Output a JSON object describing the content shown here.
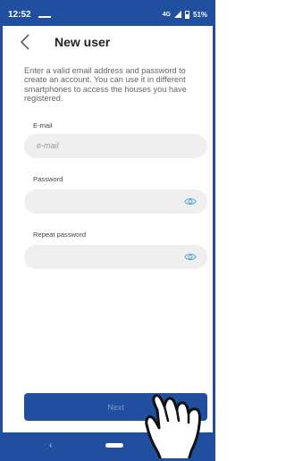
{
  "status_bar": {
    "time": "12:52",
    "network": "4G",
    "battery": "51%"
  },
  "header": {
    "title": "New user"
  },
  "description": "Enter a valid email address and password to create an account. You can use it in different smartphones to access the houses you have registered.",
  "form": {
    "email": {
      "label": "E-mail",
      "placeholder": "e-mail"
    },
    "password": {
      "label": "Password"
    },
    "repeat_password": {
      "label": "Repeat password"
    }
  },
  "next_button": {
    "label": "Next"
  },
  "colors": {
    "primary": "#1f4f9e",
    "field_bg": "#efefef",
    "accent_icon": "#4aa6d6"
  }
}
